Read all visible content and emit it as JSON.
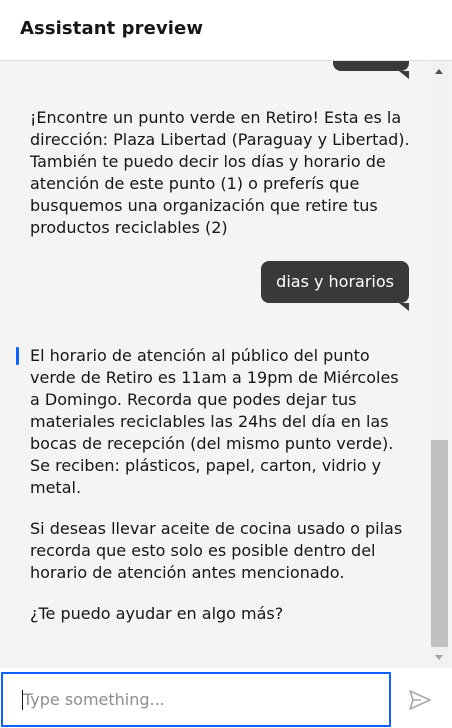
{
  "header": {
    "title": "Assistant preview"
  },
  "chat": {
    "messages": [
      {
        "role": "assistant",
        "paragraphs": [
          "¡Encontre un punto verde en Retiro! Esta es la dirección: Plaza Libertad (Paraguay y Libertad). También te puedo decir los días y horario de atención de este punto (1) o preferís que busquemos una organización que retire tus productos reciclables (2)"
        ]
      },
      {
        "role": "user",
        "text": "dias y horarios"
      },
      {
        "role": "assistant",
        "paragraphs": [
          "El horario de atención al público del punto verde de Retiro es 11am a 19pm de Miércoles a Domingo. Recorda que podes dejar tus materiales reciclables las 24hs del día en las bocas de recepción (del mismo punto verde). Se reciben: plásticos, papel, carton, vidrio y metal.",
          "Si deseas llevar aceite de cocina usado o pilas recorda que esto solo es posible dentro del horario de atención antes mencionado.",
          "¿Te puedo ayudar en algo más?"
        ]
      }
    ]
  },
  "input": {
    "placeholder": "Type something...",
    "value": ""
  },
  "icons": {
    "send": "send-icon"
  },
  "colors": {
    "accent": "#0f62fe",
    "user_bubble": "#393939",
    "chat_bg": "#f4f4f4"
  }
}
